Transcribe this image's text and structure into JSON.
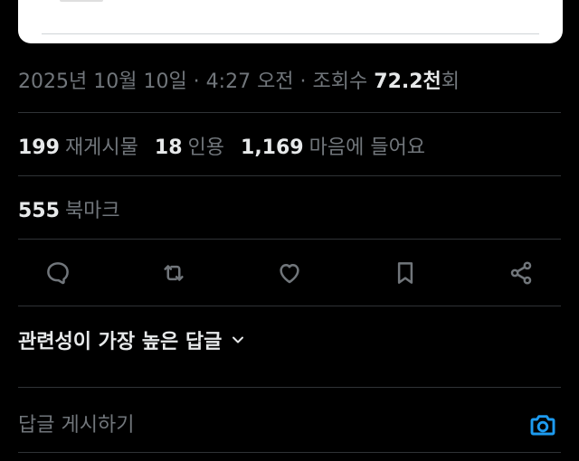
{
  "post_meta": {
    "date": "2025년 10월 10일",
    "separator_1": " · ",
    "time": "4:27 오전",
    "separator_2": " · ",
    "views_label": "조회수 ",
    "views_count": "72.2천",
    "views_suffix": "회"
  },
  "stats": {
    "reposts_count": "199",
    "reposts_label": "재게시물",
    "quotes_count": "18",
    "quotes_label": "인용",
    "likes_count": "1,169",
    "likes_label": "마음에 들어요",
    "bookmarks_count": "555",
    "bookmarks_label": "북마크"
  },
  "actions": {
    "icons": [
      "reply-icon",
      "repost-icon",
      "like-icon",
      "bookmark-icon",
      "share-icon"
    ]
  },
  "replies": {
    "sort_label": "관련성이 가장 높은 답글",
    "sort_icon": "chevron-down-icon",
    "input_placeholder": "답글 게시하기",
    "camera_icon": "camera-icon"
  },
  "colors": {
    "background": "#000000",
    "primary_text": "#e7e9ea",
    "secondary_text": "#71767b",
    "divider": "#2f3336",
    "accent": "#1d9bf0"
  }
}
